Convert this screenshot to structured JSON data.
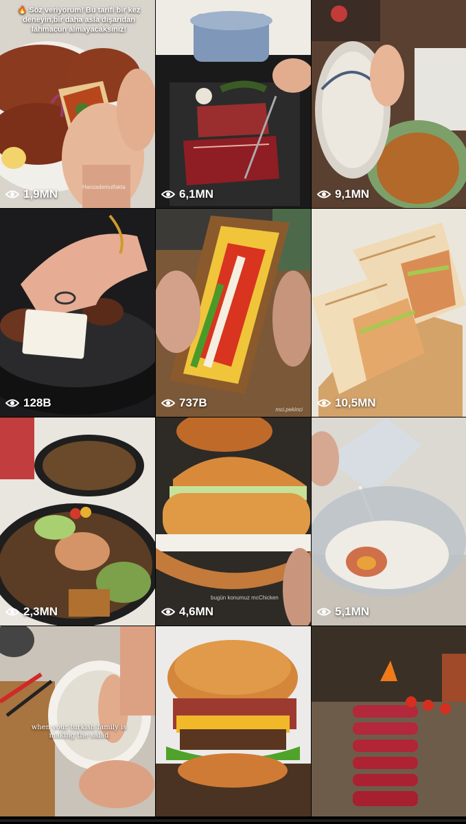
{
  "grid": {
    "tiles": [
      {
        "views": "1,9MN",
        "caption": "🔥 Söz veriyorum! Bu tarifi bir kez deneyin,bir daha asla dışarıdan lahmacun almayacaksınız!",
        "watermark": "Hanzademutfakta"
      },
      {
        "views": "6,1MN"
      },
      {
        "views": "9,1MN"
      },
      {
        "views": "128B"
      },
      {
        "views": "737B",
        "watermark": "mci.pekinci"
      },
      {
        "views": "10,5MN"
      },
      {
        "views": "2,3MN"
      },
      {
        "views": "4,6MN",
        "watermark": "bugün konumuz mcChicken"
      },
      {
        "views": "5,1MN"
      },
      {
        "views": "",
        "caption": "when your turkish family is making the salad"
      },
      {
        "views": ""
      },
      {
        "views": ""
      }
    ]
  },
  "icons": {
    "views": "eye-icon"
  },
  "colors": {
    "background": "#000000",
    "text": "#ffffff"
  }
}
